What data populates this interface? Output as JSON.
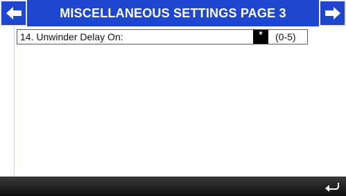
{
  "header": {
    "title": "MISCELLANEOUS SETTINGS PAGE 3",
    "prev_icon": "arrow-left-icon",
    "next_icon": "arrow-right-icon"
  },
  "settings": [
    {
      "label": "14. Unwinder Delay On:",
      "value": "*",
      "range": "(0-5)"
    }
  ],
  "footer": {
    "return_icon": "return-icon"
  },
  "colors": {
    "header_bg": "#1f46cf",
    "header_text": "#ffffff",
    "value_bg": "#000000",
    "footer_bg": "#1a1a1a"
  }
}
